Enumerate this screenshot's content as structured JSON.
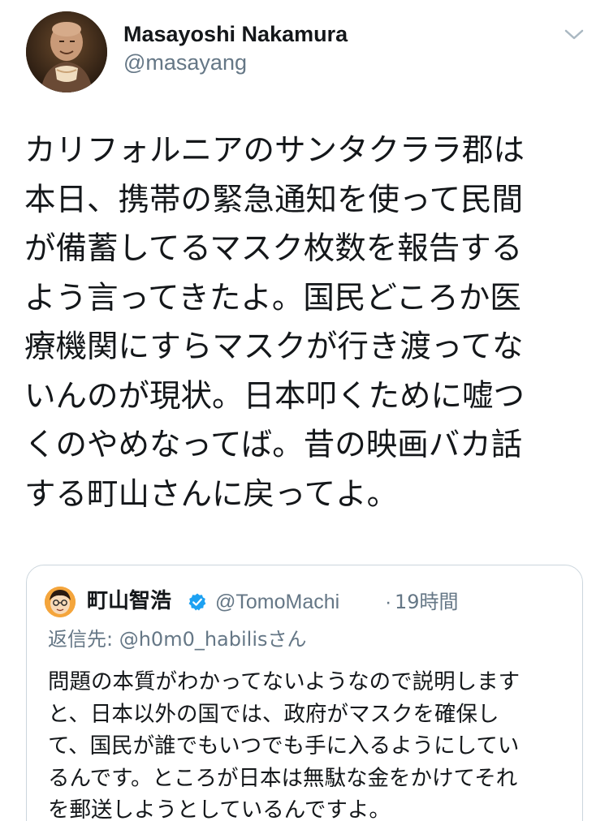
{
  "tweet": {
    "author": {
      "display_name": "Masayoshi Nakamura",
      "handle": "@masayang",
      "avatar_icon": "user-avatar"
    },
    "menu_icon": "chevron-down-icon",
    "lines": [
      "カリフォルニアのサンタクララ郡は",
      "本日、携帯の緊急通知を使って民間",
      "が備蓄してるマスク枚数を報告する",
      "よう言ってきたよ。国民どころか医",
      "療機関にすらマスクが行き渡ってな",
      "いんのが現状。日本叩くために嘘つ",
      "くのやめなってば。昔の映画バカ話",
      "する町山さんに戻ってよ。"
    ]
  },
  "quoted_tweet": {
    "author": {
      "display_name": "町山智浩",
      "verified_icon": "verified-badge-icon",
      "handle": "@TomoMachi",
      "separator": "·",
      "time": "19時間"
    },
    "reply_to": "返信先: @h0m0_habilisさん",
    "lines": [
      "問題の本質がわかってないようなので説明します",
      "と、日本以外の国では、政府がマスクを確保し",
      "て、国民が誰でもいつでも手に入るようにしてい",
      "るんです。ところが日本は無駄な金をかけてそれ",
      "を郵送しようとしているんですよ。"
    ]
  },
  "colors": {
    "text_primary": "#14171a",
    "text_secondary": "#657786",
    "border": "#ccd6dd",
    "verified_blue": "#1da1f2"
  }
}
